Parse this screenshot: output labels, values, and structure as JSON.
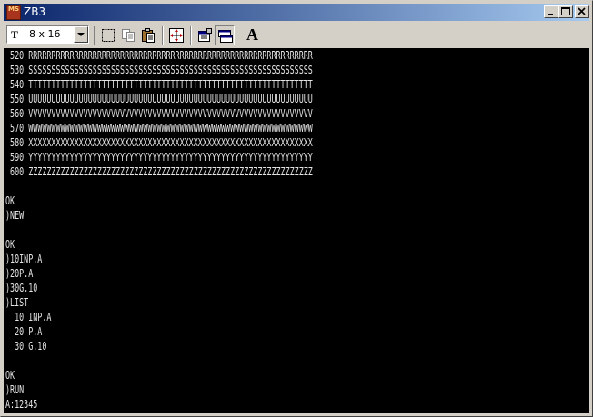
{
  "window": {
    "title": "ZB3",
    "icon_text": "MS"
  },
  "title_buttons": [
    "minimize-icon",
    "maximize-icon",
    "close-icon"
  ],
  "toolbar": {
    "font_selector": {
      "icon_glyph": "T",
      "value": "8 x 16"
    },
    "buttons": [
      {
        "name": "select-icon"
      },
      {
        "name": "copy-icon"
      },
      {
        "name": "paste-icon"
      },
      {
        "name": "fullscreen-icon"
      },
      {
        "name": "properties-icon"
      },
      {
        "name": "window-icon"
      },
      {
        "name": "font-icon",
        "glyph": "A"
      }
    ]
  },
  "terminal": {
    "lines": [
      " 520 RRRRRRRRRRRRRRRRRRRRRRRRRRRRRRRRRRRRRRRRRRRRRRRRRRRRRRRRRRRRRR",
      " 530 SSSSSSSSSSSSSSSSSSSSSSSSSSSSSSSSSSSSSSSSSSSSSSSSSSSSSSSSSSSSSS",
      " 540 TTTTTTTTTTTTTTTTTTTTTTTTTTTTTTTTTTTTTTTTTTTTTTTTTTTTTTTTTTTTTT",
      " 550 UUUUUUUUUUUUUUUUUUUUUUUUUUUUUUUUUUUUUUUUUUUUUUUUUUUUUUUUUUUUUU",
      " 560 VVVVVVVVVVVVVVVVVVVVVVVVVVVVVVVVVVVVVVVVVVVVVVVVVVVVVVVVVVVVVV",
      " 570 WWWWWWWWWWWWWWWWWWWWWWWWWWWWWWWWWWWWWWWWWWWWWWWWWWWWWWWWWWWWWW",
      " 580 XXXXXXXXXXXXXXXXXXXXXXXXXXXXXXXXXXXXXXXXXXXXXXXXXXXXXXXXXXXXXX",
      " 590 YYYYYYYYYYYYYYYYYYYYYYYYYYYYYYYYYYYYYYYYYYYYYYYYYYYYYYYYYYYYYY",
      " 600 ZZZZZZZZZZZZZZZZZZZZZZZZZZZZZZZZZZZZZZZZZZZZZZZZZZZZZZZZZZZZZZ",
      "",
      "OK",
      ")NEW",
      "",
      "OK",
      ")10INP.A",
      ")20P.A",
      ")30G.10",
      ")LIST",
      "  10 INP.A",
      "  20 P.A",
      "  30 G.10",
      "",
      "OK",
      ")RUN",
      "A:12345"
    ]
  },
  "colors": {
    "titlebar_start": "#0a246a",
    "titlebar_end": "#a6caf0",
    "terminal_bg": "#000000",
    "terminal_fg": "#e4e4e4",
    "chrome": "#d4d0c8"
  }
}
